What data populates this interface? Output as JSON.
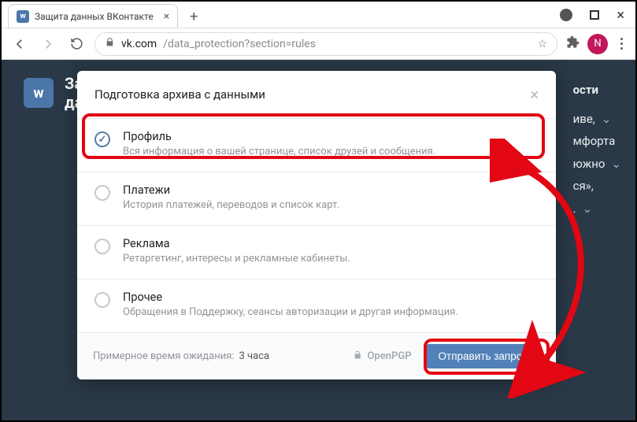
{
  "browser": {
    "tab_title": "Защита данных ВКонтакте",
    "favicon_letter": "w",
    "url_host": "vk.com",
    "url_path": "/data_protection?section=rules",
    "avatar_letter": "N"
  },
  "page_bg": {
    "header_line1": "Защ",
    "header_line2": "данн",
    "right_bold": "ости",
    "right_lines": [
      "иве,",
      "мфорта",
      "южно",
      "ся»,",
      "."
    ]
  },
  "modal": {
    "title": "Подготовка архива с данными",
    "options": [
      {
        "title": "Профиль",
        "desc": "Вся информация о вашей странице, список друзей и сообщения.",
        "checked": true
      },
      {
        "title": "Платежи",
        "desc": "История платежей, переводов и список карт.",
        "checked": false
      },
      {
        "title": "Реклама",
        "desc": "Ретаргетинг, интересы и рекламные кабинеты.",
        "checked": false
      },
      {
        "title": "Прочее",
        "desc": "Обращения в Поддержку, сеансы авторизации и другая информация.",
        "checked": false
      }
    ],
    "wait_label": "Примерное время ожидания:",
    "wait_value": "3 часа",
    "openpgp": "OpenPGP",
    "send": "Отправить запрос"
  }
}
